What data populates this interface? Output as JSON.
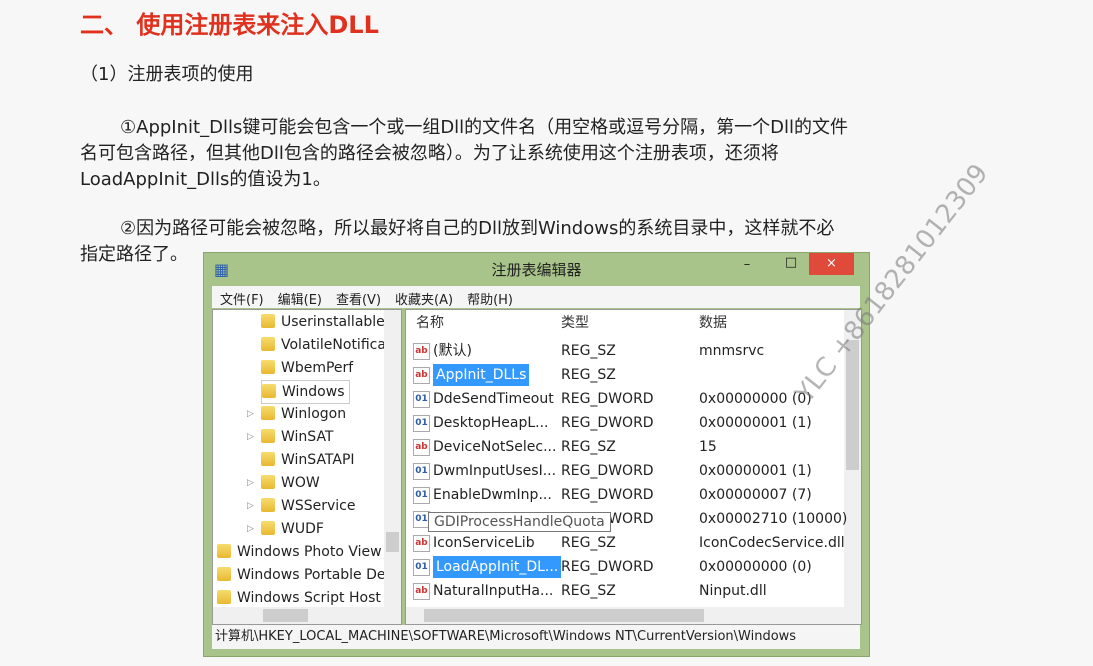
{
  "heading": "二、 使用注册表来注入DLL",
  "section": "（1）注册表项的使用",
  "para1": [
    "①AppInit_Dlls键可能会包含一个或一组Dll的文件名（用空格或逗号分隔，第一个Dll的文件",
    "名可包含路径，但其他Dll包含的路径会被忽略）。为了让系统使用这个注册表项，还须将",
    "LoadAppInit_Dlls的值设为1。"
  ],
  "para2": [
    "②因为路径可能会被忽略，所以最好将自己的Dll放到Windows的系统目录中，这样就不必",
    "指定路径了。"
  ],
  "watermark": "YLC +8618281012309",
  "window": {
    "title": "注册表编辑器",
    "minimize": "–",
    "maximize": "□",
    "close": "×",
    "menu": [
      "文件(F)",
      "编辑(E)",
      "查看(V)",
      "收藏夹(A)",
      "帮助(H)"
    ],
    "tree": [
      {
        "label": "Userinstallable",
        "level": 2,
        "expander": false
      },
      {
        "label": "VolatileNotifica",
        "level": 2,
        "expander": false
      },
      {
        "label": "WbemPerf",
        "level": 2,
        "expander": false
      },
      {
        "label": "Windows",
        "level": 2,
        "expander": false,
        "selected": true
      },
      {
        "label": "Winlogon",
        "level": 2,
        "expander": true
      },
      {
        "label": "WinSAT",
        "level": 2,
        "expander": true
      },
      {
        "label": "WinSATAPI",
        "level": 2,
        "expander": false
      },
      {
        "label": "WOW",
        "level": 2,
        "expander": true
      },
      {
        "label": "WSService",
        "level": 2,
        "expander": true
      },
      {
        "label": "WUDF",
        "level": 2,
        "expander": true
      },
      {
        "label": "Windows Photo View",
        "level": 1
      },
      {
        "label": "Windows Portable De",
        "level": 1
      },
      {
        "label": "Windows Script Host",
        "level": 1
      }
    ],
    "columns": [
      "名称",
      "类型",
      "数据"
    ],
    "rows": [
      {
        "icon": "ab",
        "name": "(默认)",
        "type": "REG_SZ",
        "data": "mnmsrvc"
      },
      {
        "icon": "ab",
        "name": "AppInit_DLLs",
        "type": "REG_SZ",
        "data": "",
        "selected": true
      },
      {
        "icon": "dw",
        "name": "DdeSendTimeout",
        "type": "REG_DWORD",
        "data": "0x00000000 (0)"
      },
      {
        "icon": "dw",
        "name": "DesktopHeapL...",
        "type": "REG_DWORD",
        "data": "0x00000001 (1)"
      },
      {
        "icon": "ab",
        "name": "DeviceNotSelec...",
        "type": "REG_SZ",
        "data": "15"
      },
      {
        "icon": "dw",
        "name": "DwmInputUsesI...",
        "type": "REG_DWORD",
        "data": "0x00000001 (1)"
      },
      {
        "icon": "dw",
        "name": "EnableDwmInp...",
        "type": "REG_DWORD",
        "data": "0x00000007 (7)"
      },
      {
        "icon": "dw",
        "name": "GDIProcessHandleQuota",
        "type": "REG_DWORD",
        "data": "0x00002710 (10000)"
      },
      {
        "icon": "ab",
        "name": "IconServiceLib",
        "type": "REG_SZ",
        "data": "IconCodecService.dll"
      },
      {
        "icon": "dw",
        "name": "LoadAppInit_DL...",
        "type": "REG_DWORD",
        "data": "0x00000000 (0)",
        "selected": true
      },
      {
        "icon": "ab",
        "name": "NaturalInputHa...",
        "type": "REG_SZ",
        "data": "Ninput.dll"
      }
    ],
    "tooltip": "GDIProcessHandleQuota",
    "status": "计算机\\HKEY_LOCAL_MACHINE\\SOFTWARE\\Microsoft\\Windows NT\\CurrentVersion\\Windows"
  }
}
